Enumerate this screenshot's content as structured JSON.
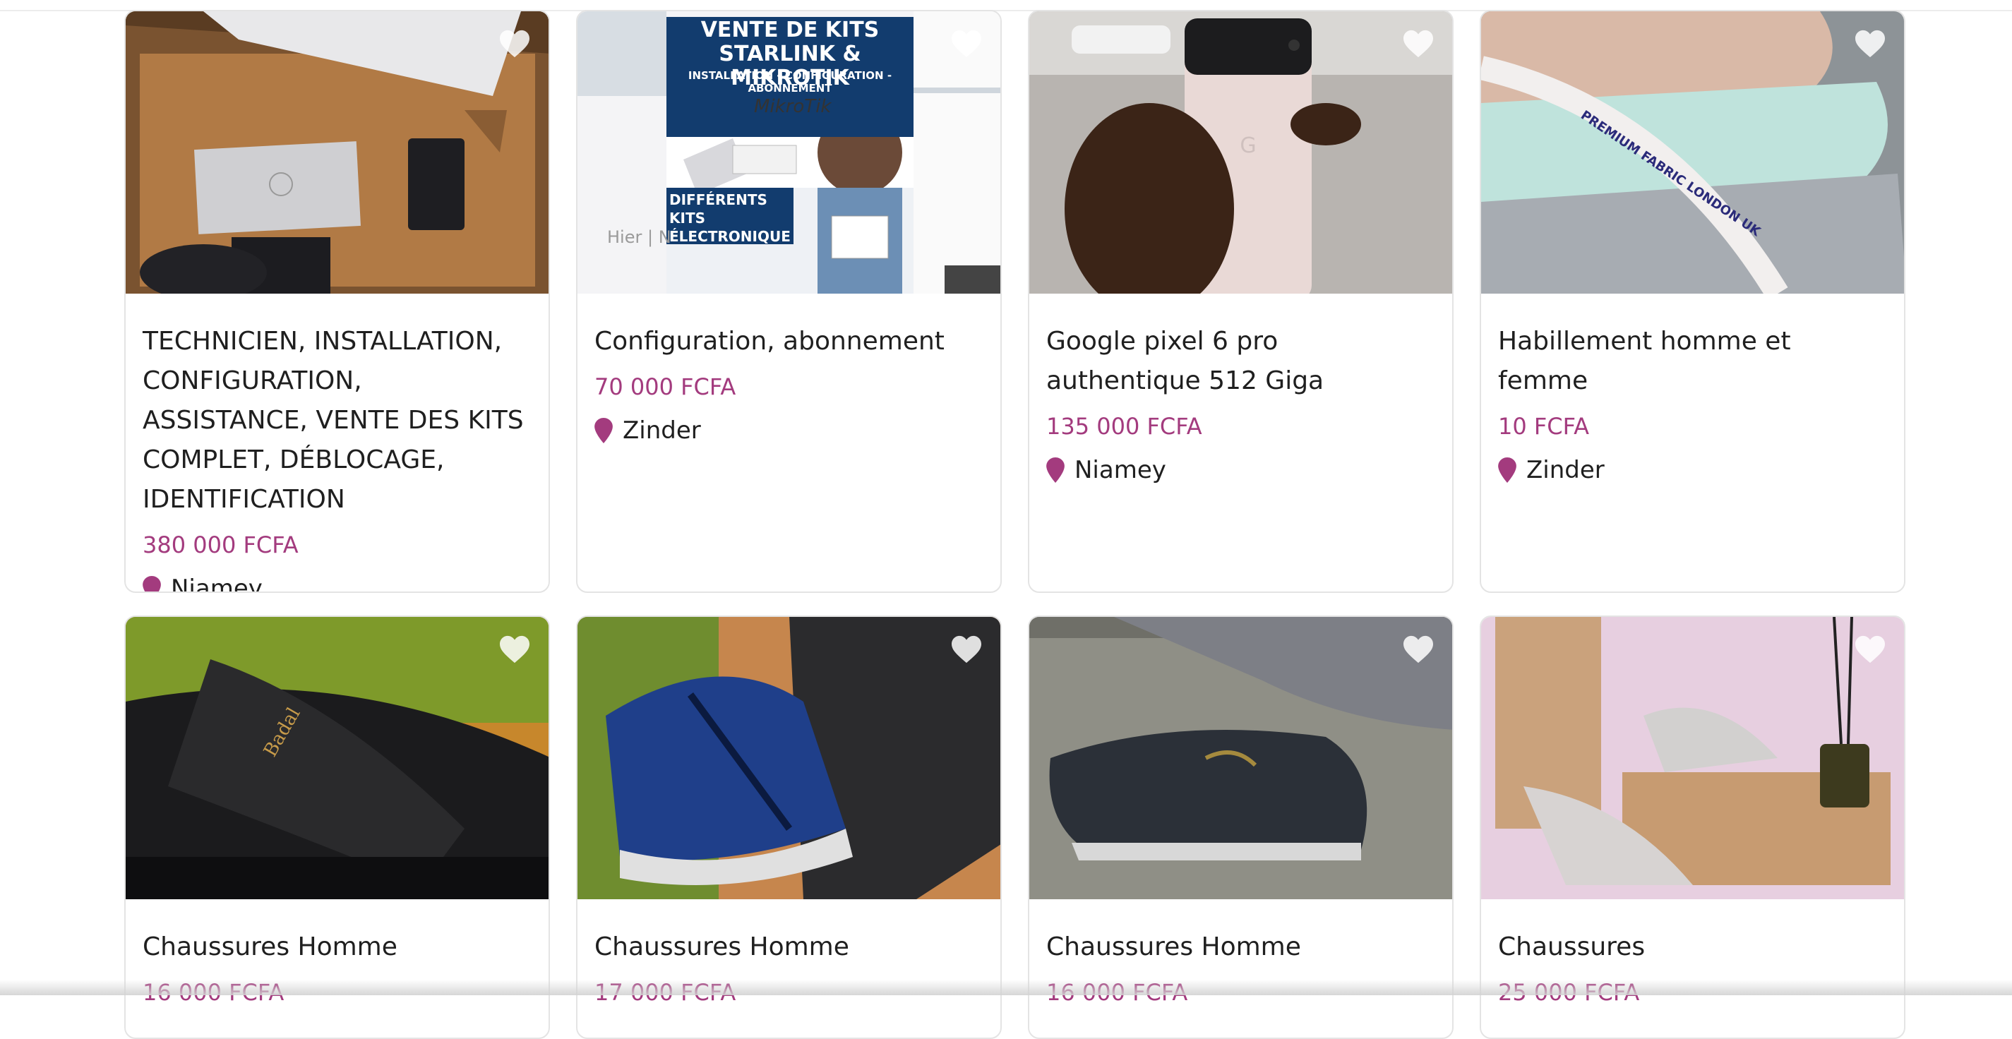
{
  "listings": [
    {
      "title": "TECHNICIEN, INSTALLATION, CONFIGURATION, ASSISTANCE, VENTE DES KITS COMPLET, DÉBLOCAGE, IDENTIFICATION",
      "price": "380 000 FCFA",
      "location": "Niamey",
      "image": "starlink-kit-photo"
    },
    {
      "title": "Configuration, abonnement",
      "price": "70 000 FCFA",
      "location": "Zinder",
      "image": "starlink-mikrotik-ad",
      "ad_text": {
        "headline": "VENTE DE KITS STARLINK & MIKROTIK",
        "subline": "INSTALLATION - CONFIGURATION - ABONNEMENT",
        "brand": "MikroTik",
        "kits": "DIFFÉRENTS KITS ÉLECTRONIQUE",
        "hier": "Hier | N"
      }
    },
    {
      "title": "Google pixel 6 pro authentique 512 Giga",
      "price": "135 000 FCFA",
      "location": "Niamey",
      "image": "pixel-phone-photo"
    },
    {
      "title": "Habillement homme et femme",
      "price": "10 FCFA",
      "location": "Zinder",
      "image": "fabric-photo",
      "ad_text": {
        "ribbon": "PREMIUM FABRIC LONDON UK"
      }
    },
    {
      "title": "Chaussures Homme",
      "price": "16 000 FCFA",
      "location": "",
      "image": "black-shoe-photo"
    },
    {
      "title": "Chaussures Homme",
      "price": "17 000 FCFA",
      "location": "",
      "image": "blue-shoe-photo"
    },
    {
      "title": "Chaussures Homme",
      "price": "16 000 FCFA",
      "location": "",
      "image": "loafer-photo"
    },
    {
      "title": "Chaussures",
      "price": "25 000 FCFA",
      "location": "",
      "image": "heels-photo"
    }
  ],
  "colors": {
    "accent": "#a33b7e",
    "text": "#1f1f1f",
    "border": "#e4e4e4"
  },
  "icons": {
    "favorite": "heart-icon",
    "location": "map-pin-icon"
  }
}
